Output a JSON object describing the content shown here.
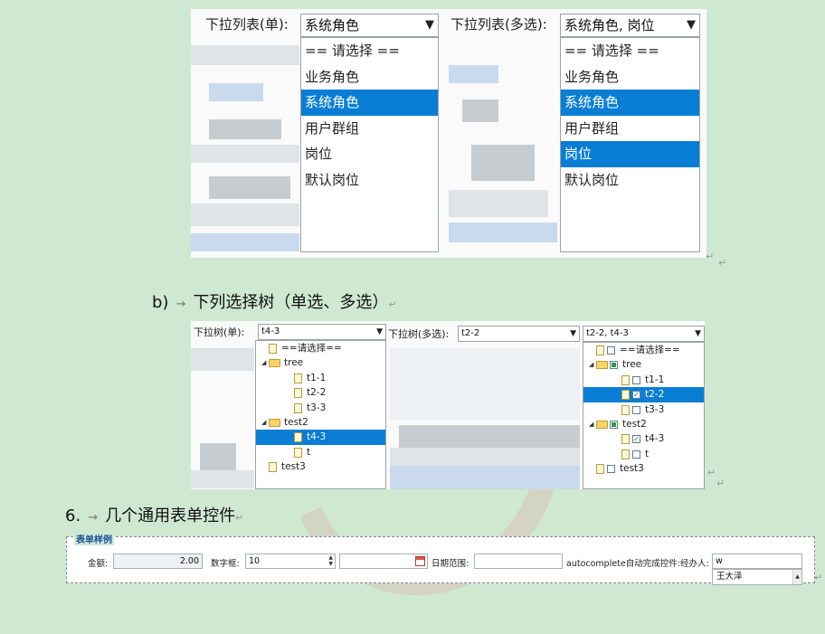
{
  "dropdowns": {
    "single": {
      "label": "下拉列表(单):",
      "value": "系统角色",
      "options": [
        "== 请选择 ==",
        "业务角色",
        "系统角色",
        "用户群组",
        "岗位",
        "默认岗位"
      ],
      "selected": [
        2
      ]
    },
    "multi": {
      "label": "下拉列表(多选):",
      "value": "系统角色, 岗位",
      "options": [
        "== 请选择 ==",
        "业务角色",
        "系统角色",
        "用户群组",
        "岗位",
        "默认岗位"
      ],
      "selected": [
        2,
        4
      ]
    }
  },
  "section_b": {
    "prefix": "b)",
    "arrow": "→",
    "title": "下列选择树（单选、多选）",
    "pilcrow": "↵"
  },
  "trees": {
    "single": {
      "label": "下拉树(单):",
      "value": "t4-3",
      "nodes": [
        {
          "text": "==请选择==",
          "type": "file",
          "level": 0
        },
        {
          "text": "tree",
          "type": "folder",
          "level": 0
        },
        {
          "text": "t1-1",
          "type": "file",
          "level": 1
        },
        {
          "text": "t2-2",
          "type": "file",
          "level": 1
        },
        {
          "text": "t3-3",
          "type": "file",
          "level": 1
        },
        {
          "text": "test2",
          "type": "folder",
          "level": 0
        },
        {
          "text": "t4-3",
          "type": "file",
          "level": 1,
          "selected": true
        },
        {
          "text": "t",
          "type": "file",
          "level": 1
        },
        {
          "text": "test3",
          "type": "file",
          "level": 0
        }
      ]
    },
    "multi": {
      "label": "下拉树(多选):",
      "value": "t2-2",
      "value2": "t2-2, t4-3",
      "nodes": [
        {
          "text": "==请选择==",
          "type": "file",
          "level": 0,
          "check": "none"
        },
        {
          "text": "tree",
          "type": "folder",
          "level": 0,
          "check": "partial"
        },
        {
          "text": "t1-1",
          "type": "file",
          "level": 1,
          "check": "none"
        },
        {
          "text": "t2-2",
          "type": "file",
          "level": 1,
          "check": "checked",
          "selected": true
        },
        {
          "text": "t3-3",
          "type": "file",
          "level": 1,
          "check": "none"
        },
        {
          "text": "test2",
          "type": "folder",
          "level": 0,
          "check": "partial"
        },
        {
          "text": "t4-3",
          "type": "file",
          "level": 1,
          "check": "checked"
        },
        {
          "text": "t",
          "type": "file",
          "level": 1,
          "check": "none"
        },
        {
          "text": "test3",
          "type": "file",
          "level": 0,
          "check": "none"
        }
      ]
    }
  },
  "section_6": {
    "prefix": "6.",
    "arrow": "→",
    "title": "几个通用表单控件",
    "pilcrow": "↵"
  },
  "form": {
    "legend": "表单样例",
    "amount_label": "金额:",
    "amount_value": "2.00",
    "number_label": "数字框:",
    "number_value": "10",
    "date_value": "",
    "range_label": "日期范围:",
    "range_value": "",
    "autocomplete_label": "autocomplete自动完成控件:经办人:",
    "autocomplete_value": "w",
    "suggestion": "王大泽"
  },
  "icons": {
    "dropdown": "chevron-down-icon",
    "file": "file-icon",
    "folder": "folder-icon",
    "calendar": "calendar-icon",
    "spinner": "spinner-arrows-icon"
  }
}
